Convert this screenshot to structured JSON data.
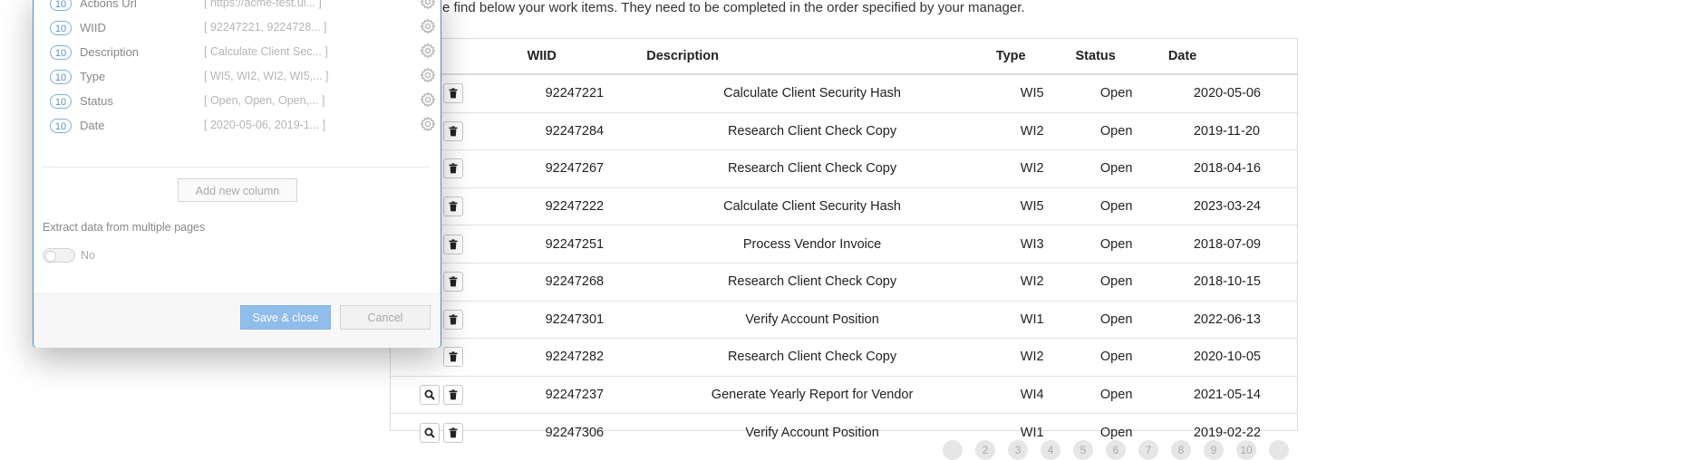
{
  "page": {
    "intro_text": "e find below your work items. They need to be completed in the order specified by your manager."
  },
  "table": {
    "headers": {
      "actions": "s",
      "wiid": "WIID",
      "description": "Description",
      "type": "Type",
      "status": "Status",
      "date": "Date"
    },
    "rows": [
      {
        "wiid": "92247221",
        "description": "Calculate Client Security Hash",
        "type": "WI5",
        "status": "Open",
        "date": "2020-05-06",
        "has_search": false
      },
      {
        "wiid": "92247284",
        "description": "Research Client Check Copy",
        "type": "WI2",
        "status": "Open",
        "date": "2019-11-20",
        "has_search": false
      },
      {
        "wiid": "92247267",
        "description": "Research Client Check Copy",
        "type": "WI2",
        "status": "Open",
        "date": "2018-04-16",
        "has_search": false
      },
      {
        "wiid": "92247222",
        "description": "Calculate Client Security Hash",
        "type": "WI5",
        "status": "Open",
        "date": "2023-03-24",
        "has_search": false
      },
      {
        "wiid": "92247251",
        "description": "Process Vendor Invoice",
        "type": "WI3",
        "status": "Open",
        "date": "2018-07-09",
        "has_search": false
      },
      {
        "wiid": "92247268",
        "description": "Research Client Check Copy",
        "type": "WI2",
        "status": "Open",
        "date": "2018-10-15",
        "has_search": false
      },
      {
        "wiid": "92247301",
        "description": "Verify Account Position",
        "type": "WI1",
        "status": "Open",
        "date": "2022-06-13",
        "has_search": false
      },
      {
        "wiid": "92247282",
        "description": "Research Client Check Copy",
        "type": "WI2",
        "status": "Open",
        "date": "2020-10-05",
        "has_search": false
      },
      {
        "wiid": "92247237",
        "description": "Generate Yearly Report for Vendor",
        "type": "WI4",
        "status": "Open",
        "date": "2021-05-14",
        "has_search": true
      },
      {
        "wiid": "92247306",
        "description": "Verify Account Position",
        "type": "WI1",
        "status": "Open",
        "date": "2019-02-22",
        "has_search": true
      }
    ],
    "icons": {
      "search": "magnifier-icon",
      "delete": "trash-icon"
    }
  },
  "pagination": {
    "pages": [
      "",
      "2",
      "3",
      "4",
      "5",
      "6",
      "7",
      "8",
      "9",
      "10",
      ""
    ]
  },
  "modal": {
    "columns": [
      {
        "count": "10",
        "name": "Actions Url",
        "sample": "[ https://acme-test.ui... ]"
      },
      {
        "count": "10",
        "name": "WIID",
        "sample": "[ 92247221, 9224728... ]"
      },
      {
        "count": "10",
        "name": "Description",
        "sample": "[ Calculate Client Sec... ]"
      },
      {
        "count": "10",
        "name": "Type",
        "sample": "[ WI5, WI2, WI2, WI5,... ]"
      },
      {
        "count": "10",
        "name": "Status",
        "sample": "[ Open, Open, Open,... ]"
      },
      {
        "count": "10",
        "name": "Date",
        "sample": "[ 2020-05-06, 2019-1... ]"
      }
    ],
    "add_column_label": "Add new column",
    "extract_label": "Extract data from multiple pages",
    "toggle_value": "No",
    "save_label": "Save & close",
    "cancel_label": "Cancel",
    "colors": {
      "accent": "#4a90d9",
      "save_bg": "#8fbdec"
    }
  }
}
